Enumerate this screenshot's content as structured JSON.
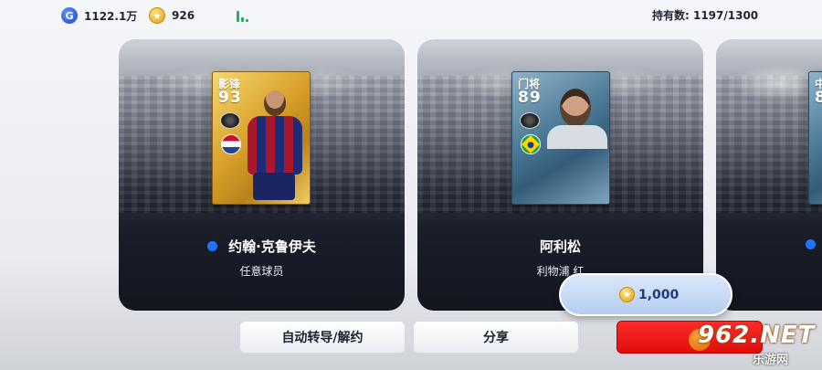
{
  "topbar": {
    "gp_icon": "G",
    "gp_value": "1122.1万",
    "coin_icon": "star-coin",
    "coin_value": "926",
    "signal_icon": "signal-bars",
    "owned_label": "持有数: 1197/1300"
  },
  "players": [
    {
      "position": "影锋",
      "rating": "93",
      "name": "约翰·克鲁伊夫",
      "team": "任意球员",
      "flag": "netherlands-flag",
      "card_style": "gold"
    },
    {
      "position": "门将",
      "rating": "89",
      "name": "阿利松",
      "team": "利物浦 红",
      "flag": "brazil-flag",
      "card_style": "blue"
    },
    {
      "position": "中",
      "rating": "8",
      "name": "",
      "team": "",
      "flag": "",
      "card_style": "blue"
    }
  ],
  "price": {
    "value": "1,000",
    "icon": "star-coin"
  },
  "buttons": {
    "transfer": "自动转导/解约",
    "share": "分享",
    "red": ""
  },
  "watermark": {
    "big": "962.NET",
    "small": "乐游网"
  },
  "colors": {
    "accent_blue": "#1e74ff",
    "red_button": "#e00d0d",
    "gold_card": "#d9a02a",
    "blue_card": "#4f7d9a"
  }
}
